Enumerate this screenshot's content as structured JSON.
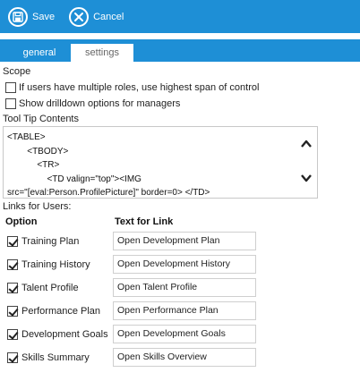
{
  "toolbar": {
    "save_label": "Save",
    "cancel_label": "Cancel"
  },
  "tabs": [
    {
      "label": "general",
      "active": false
    },
    {
      "label": "settings",
      "active": true
    }
  ],
  "scope": {
    "label": "Scope",
    "options": [
      {
        "label": "If users have multiple roles, use highest span of control",
        "checked": false
      },
      {
        "label": "Show drilldown options for managers",
        "checked": false
      }
    ]
  },
  "tooltip": {
    "label": "Tool Tip Contents",
    "lines": [
      "<TABLE>",
      "        <TBODY>",
      "            <TR>",
      "                <TD valign=\"top\"><IMG",
      "src=\"[eval:Person.ProfilePicture]\" border=0> </TD>"
    ]
  },
  "links": {
    "label": "Links for Users:",
    "option_header": "Option",
    "text_header": "Text for Link",
    "rows": [
      {
        "option": "Training Plan",
        "checked": true,
        "text": "Open Development Plan"
      },
      {
        "option": "Training History",
        "checked": true,
        "text": "Open Development History"
      },
      {
        "option": "Talent Profile",
        "checked": true,
        "text": "Open Talent Profile"
      },
      {
        "option": "Performance Plan",
        "checked": true,
        "text": "Open Performance Plan"
      },
      {
        "option": "Development Goals",
        "checked": true,
        "text": "Open Development Goals"
      },
      {
        "option": "Skills Summary",
        "checked": true,
        "text": "Open Skills Overview"
      }
    ]
  },
  "colors": {
    "accent": "#1e8fd6"
  },
  "icons": {
    "save": "floppy-disk-icon",
    "cancel": "close-circle-icon",
    "scroll_up": "chevron-up-icon",
    "scroll_down": "chevron-down-icon"
  }
}
